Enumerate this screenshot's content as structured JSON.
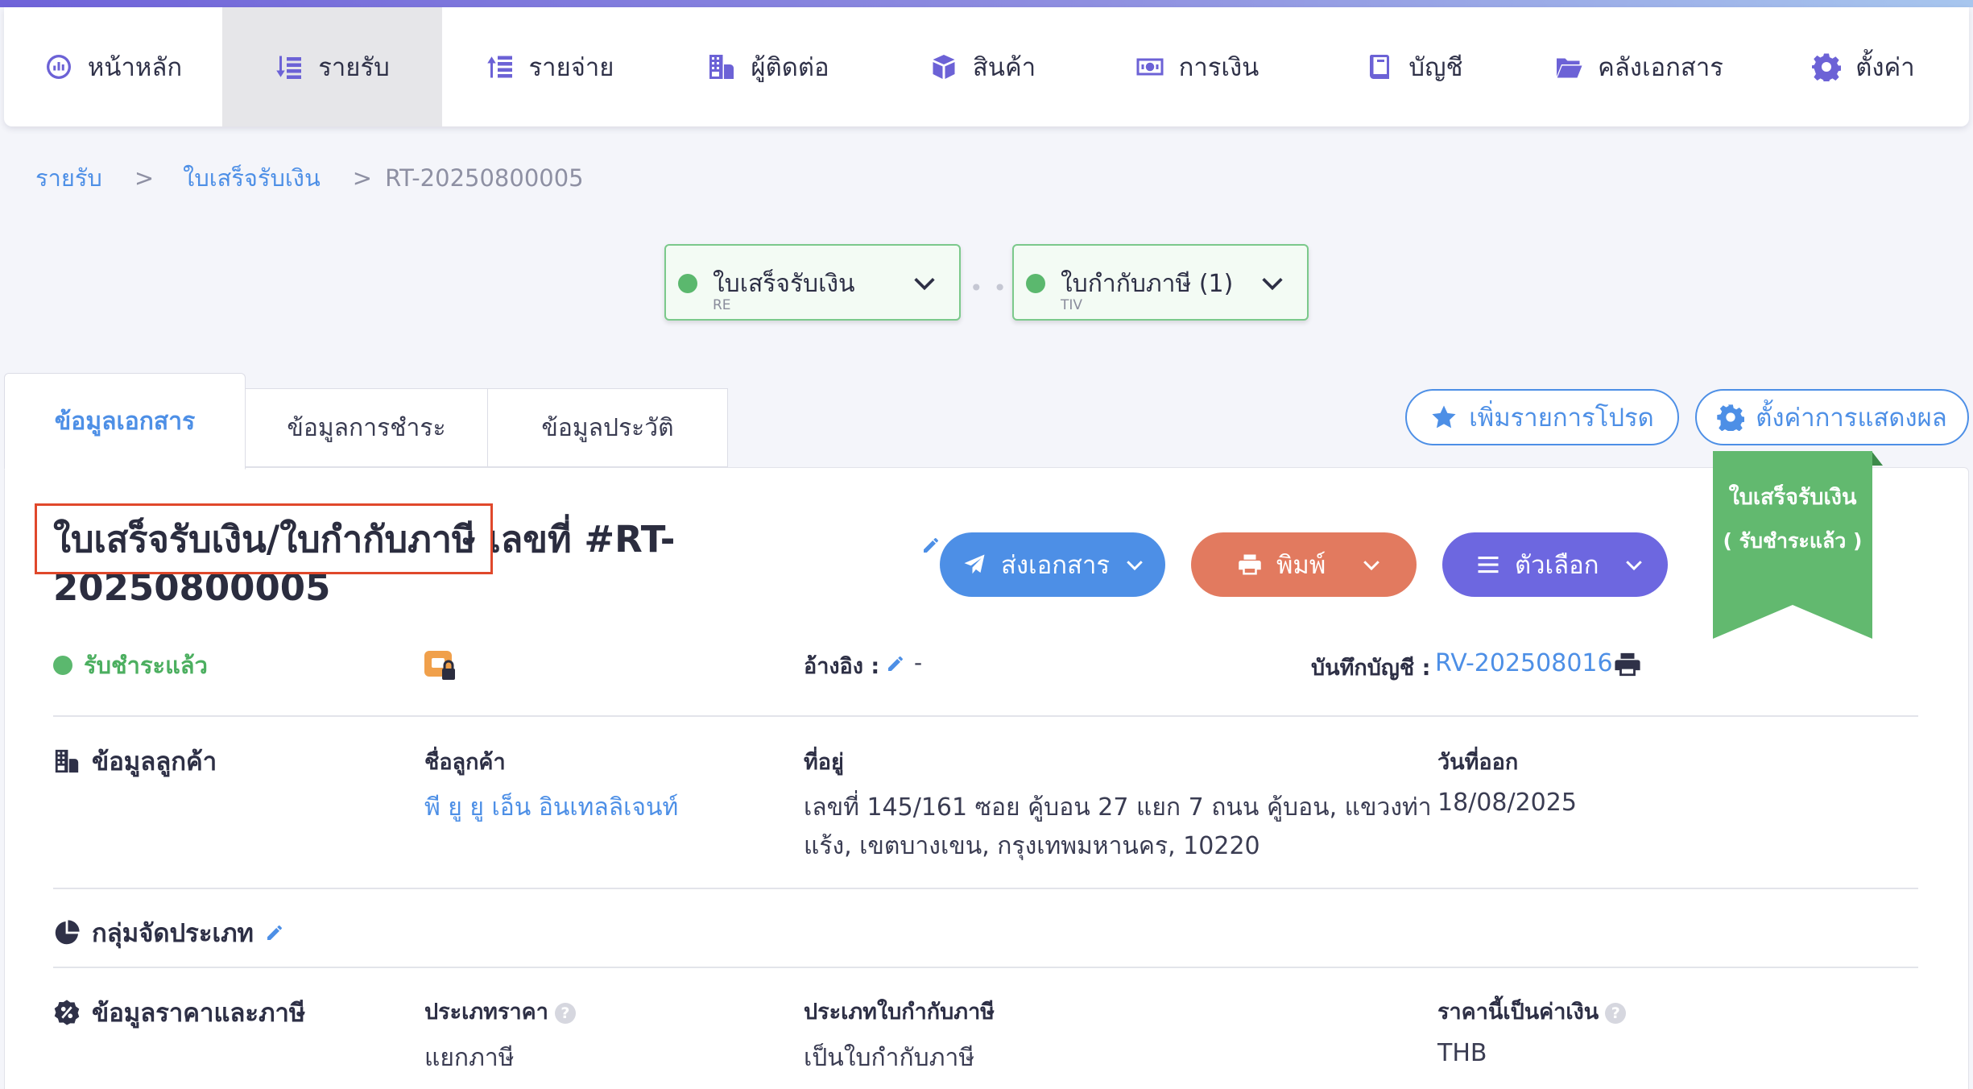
{
  "nav": {
    "items": [
      {
        "label": "หน้าหลัก",
        "icon": "dashboard-icon"
      },
      {
        "label": "รายรับ",
        "icon": "income-icon",
        "active": true
      },
      {
        "label": "รายจ่าย",
        "icon": "expense-icon"
      },
      {
        "label": "ผู้ติดต่อ",
        "icon": "contacts-icon"
      },
      {
        "label": "สินค้า",
        "icon": "box-icon"
      },
      {
        "label": "การเงิน",
        "icon": "money-icon"
      },
      {
        "label": "บัญชี",
        "icon": "book-icon"
      },
      {
        "label": "คลังเอกสาร",
        "icon": "folder-icon"
      },
      {
        "label": "ตั้งค่า",
        "icon": "gear-icon"
      }
    ]
  },
  "breadcrumb": {
    "root": "รายรับ",
    "sep": ">",
    "section": "ใบเสร็จรับเงิน",
    "current": "RT-20250800005"
  },
  "flow": {
    "receipt": {
      "title": "ใบเสร็จรับเงิน",
      "code": "RE"
    },
    "tax_invoice": {
      "title": "ใบกำกับภาษี (1)",
      "code": "TIV"
    },
    "connector": "• • •"
  },
  "tabs": {
    "doc_info": "ข้อมูลเอกสาร",
    "payment_info": "ข้อมูลการชำระ",
    "history": "ข้อมูลประวัติ"
  },
  "toolbar": {
    "favorite": "เพิ่มรายการโปรด",
    "display_settings": "ตั้งค่าการแสดงผล"
  },
  "document": {
    "title_line1": "ใบเสร็จรับเงิน/ใบกำกับภาษี เลขที่ #RT-",
    "title_line2": "20250800005",
    "status": "รับชำระแล้ว",
    "ref_label": "อ้างอิง :",
    "ref_value": "-",
    "journal_label": "บันทึกบัญชี :",
    "journal_value": "RV-202508016"
  },
  "actions": {
    "send": "ส่งเอกสาร",
    "print": "พิมพ์",
    "options": "ตัวเลือก"
  },
  "ribbon": {
    "line1": "ใบเสร็จรับเงิน",
    "line2": "( รับชำระแล้ว )"
  },
  "customer": {
    "section": "ข้อมูลลูกค้า",
    "name_label": "ชื่อลูกค้า",
    "name": "พี ยู ยู เอ็น อินเทลลิเจนท์",
    "address_label": "ที่อยู่",
    "address_line1": "เลขที่ 145/161 ซอย คู้บอน 27 แยก 7 ถนน คู้บอน, แขวงท่า",
    "address_line2": "แร้ง, เขตบางเขน, กรุงเทพมหานคร, 10220",
    "date_label": "วันที่ออก",
    "date": "18/08/2025"
  },
  "category": {
    "section": "กลุ่มจัดประเภท"
  },
  "pricing": {
    "section": "ข้อมูลราคาและภาษี",
    "price_type_label": "ประเภทราคา",
    "price_type": "แยกภาษี",
    "tax_invoice_type_label": "ประเภทใบกำกับภาษี",
    "tax_invoice_type": "เป็นใบกำกับภาษี",
    "currency_label": "ราคานี้เป็นค่าเงิน",
    "currency": "THB",
    "help": "?"
  },
  "colors": {
    "primary": "#4d8fe6",
    "nav_icon": "#6c62d6",
    "send_btn": "#4d8fe6",
    "print_btn": "#e27a5f",
    "options_btn": "#6d67e0",
    "ribbon": "#62b96f",
    "status_green": "#4caf60",
    "highlight": "#e0482b"
  }
}
